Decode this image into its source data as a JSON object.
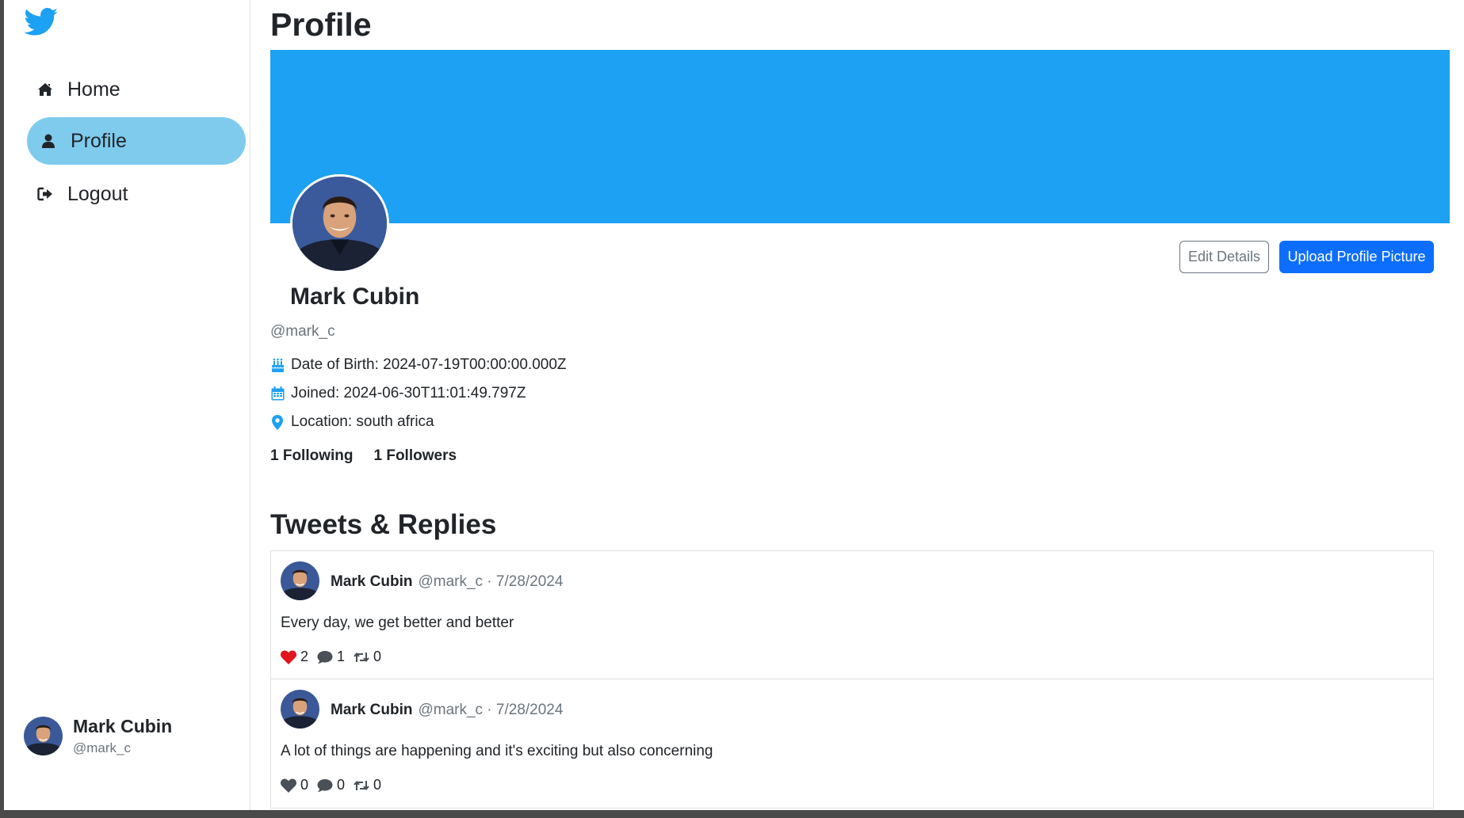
{
  "sidebar": {
    "logo": "twitter-bird-icon",
    "items": [
      {
        "label": "Home",
        "icon": "home-icon"
      },
      {
        "label": "Profile",
        "icon": "user-icon",
        "active": true
      },
      {
        "label": "Logout",
        "icon": "logout-icon"
      }
    ],
    "user": {
      "name": "Mark Cubin",
      "handle": "@mark_c"
    }
  },
  "page": {
    "title": "Profile"
  },
  "profile": {
    "name": "Mark Cubin",
    "handle": "@mark_c",
    "dob": "Date of Birth: 2024-07-19T00:00:00.000Z",
    "joined": "Joined: 2024-06-30T11:01:49.797Z",
    "location": "Location: south africa",
    "following": "1 Following",
    "followers": "1 Followers",
    "edit_label": "Edit Details",
    "upload_label": "Upload Profile Picture"
  },
  "colors": {
    "banner": "#1da1f2",
    "accent": "#1da1f2",
    "active_nav": "#7fcbed",
    "primary_button": "#0d6efd",
    "like_active": "#e0151d"
  },
  "tweets_section": {
    "title": "Tweets & Replies"
  },
  "tweets": [
    {
      "name": "Mark Cubin",
      "meta": "@mark_c · 7/28/2024",
      "text": "Every day, we get better and better",
      "likes": "2",
      "comments": "1",
      "retweets": "0",
      "liked": true
    },
    {
      "name": "Mark Cubin",
      "meta": "@mark_c · 7/28/2024",
      "text": "A lot of things are happening and it's exciting but also concerning",
      "likes": "0",
      "comments": "0",
      "retweets": "0",
      "liked": false
    }
  ]
}
